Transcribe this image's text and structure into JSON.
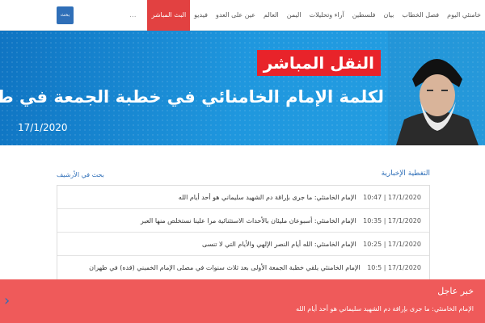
{
  "nav": {
    "items": [
      "خامنئي اليوم",
      "فصل الخطاب",
      "بيان",
      "فلسطين",
      "آراء وتحليلات",
      "اليمن",
      "العالم",
      "عين على العدو",
      "فيديو",
      "البث المباشر"
    ],
    "more": "...",
    "search_label": "بحث"
  },
  "hero": {
    "live_label": "النقل المباشر",
    "title": "لكلمة الإمام  الخامنائي في خطبة الجمعة في طهران",
    "date": "17/1/2020"
  },
  "feed": {
    "title": "التغطية الإخبارية",
    "archive_link": "بحث في الأرشيف",
    "rows": [
      {
        "time": "17/1/2020 | 10:47",
        "text": "الإمام الخامنئي: ما جرى بإراقة دم الشهيد سليماني هو أحد أيام الله"
      },
      {
        "time": "17/1/2020 | 10:35",
        "text": "الإمام الخامنئي: أسبوعان مليئان بالأحداث الاستثنائية مرا علينا نستخلص منها العبر"
      },
      {
        "time": "17/1/2020 | 10:25",
        "text": "الإمام الخامنئي: الله أيام النصر الإلهي والأيام التي لا تنسى"
      },
      {
        "time": "17/1/2020 | 10:5",
        "text": "الإمام الخامنئي يلقي خطبة الجمعة الأولى بعد ثلاث سنوات في مصلى الإمام الخميني (قده) في طهران"
      }
    ]
  },
  "breaking": {
    "title": "خبر عاجل",
    "text": "الإمام الخامنئي: ما جرى بإراقة دم الشهيد سليماني هو أحد أيام الله"
  }
}
